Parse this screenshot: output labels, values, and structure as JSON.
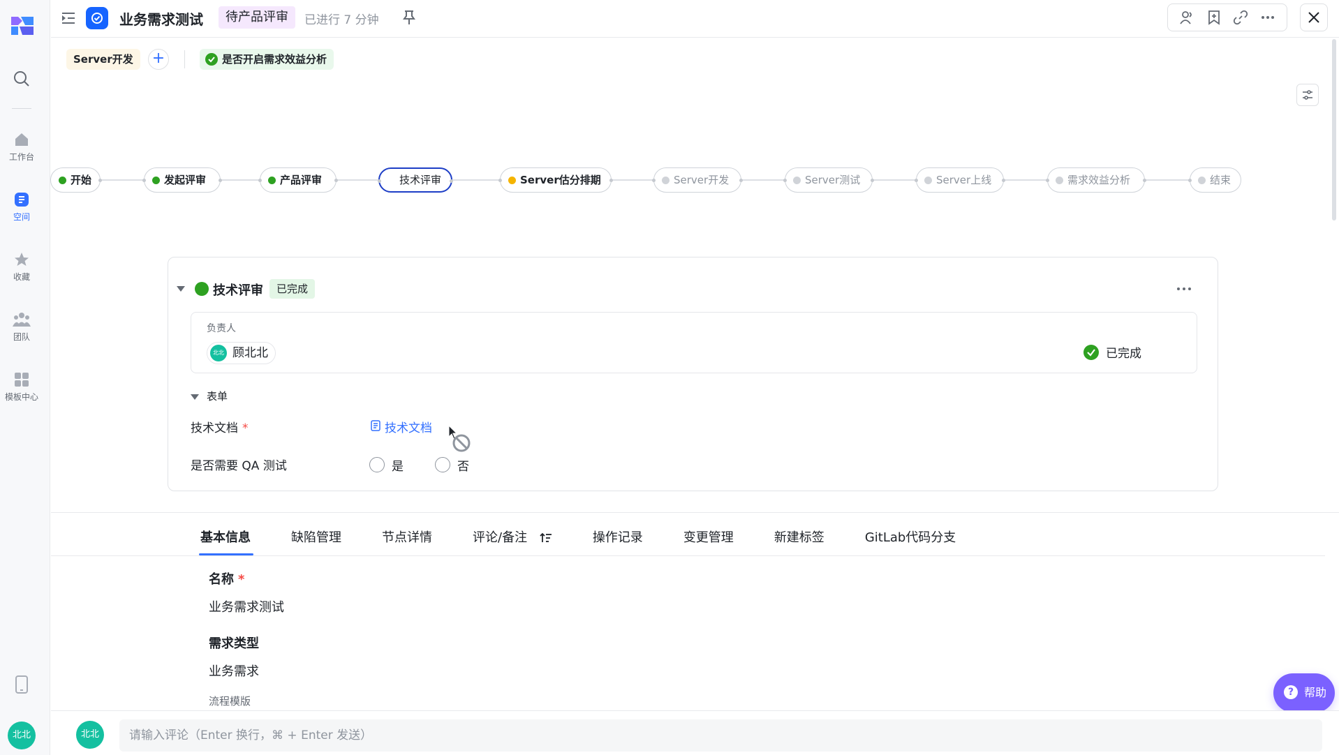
{
  "rail": {
    "items": [
      {
        "label": "工作台",
        "icon": "home-icon"
      },
      {
        "label": "空间",
        "icon": "space-icon"
      },
      {
        "label": "收藏",
        "icon": "star-icon"
      },
      {
        "label": "团队",
        "icon": "team-icon"
      },
      {
        "label": "模板中心",
        "icon": "template-icon"
      }
    ],
    "avatar": "北北"
  },
  "header": {
    "title": "业务需求测试",
    "status": "待产品评审",
    "elapsed": "已进行 7 分钟"
  },
  "chips": {
    "server": "Server开发",
    "add": "+",
    "benefit": "是否开启需求效益分析"
  },
  "flow": {
    "nodes": [
      {
        "label": "开始",
        "state": "done"
      },
      {
        "label": "发起评审",
        "state": "done"
      },
      {
        "label": "产品评审",
        "state": "done"
      },
      {
        "label": "技术评审",
        "state": "current"
      },
      {
        "label": "Server估分排期",
        "state": "progress"
      },
      {
        "label": "Server开发",
        "state": "pending"
      },
      {
        "label": "Server测试",
        "state": "pending"
      },
      {
        "label": "Server上线",
        "state": "pending"
      },
      {
        "label": "需求效益分析",
        "state": "pending"
      },
      {
        "label": "结束",
        "state": "pending"
      }
    ]
  },
  "card": {
    "title": "技术评审",
    "badge": "已完成",
    "owner_label": "负责人",
    "owner_name": "顾北北",
    "owner_avatar": "北北",
    "owner_status": "已完成",
    "form_label": "表单",
    "doc_field": "技术文档",
    "doc_link": "技术文档",
    "qa_field": "是否需要 QA 测试",
    "qa_yes": "是",
    "qa_no": "否",
    "required_mark": "*"
  },
  "tabs": [
    "基本信息",
    "缺陷管理",
    "节点详情",
    "评论/备注",
    "操作记录",
    "变更管理",
    "新建标签",
    "GitLab代码分支"
  ],
  "info": {
    "name_label": "名称",
    "name_value": "业务需求测试",
    "type_label": "需求类型",
    "type_value": "业务需求",
    "template_label": "流程模版"
  },
  "help": {
    "label": "帮助"
  },
  "comment": {
    "avatar": "北北",
    "placeholder": "请输入评论（Enter 换行，⌘ + Enter 发送）"
  },
  "colors": {
    "accent": "#3370ff",
    "done": "#2ea121",
    "progress": "#f5b400",
    "current_border": "#1d3ec6",
    "help": "#7b61ff"
  }
}
